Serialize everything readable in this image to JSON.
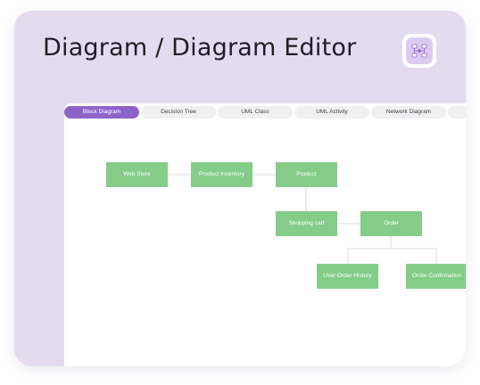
{
  "header": {
    "title": "Diagram / Diagram Editor",
    "icon": "diagram-editor-icon"
  },
  "tabs": [
    {
      "label": "Block Diagram",
      "active": true
    },
    {
      "label": "Decision Tree",
      "active": false
    },
    {
      "label": "UML Class",
      "active": false
    },
    {
      "label": "UML Activity",
      "active": false
    },
    {
      "label": "Network Diagram",
      "active": false
    },
    {
      "label": "",
      "active": false
    }
  ],
  "diagram": {
    "nodes": [
      {
        "id": "web-store",
        "label": "Web Store"
      },
      {
        "id": "product-inventory",
        "label": "Product Inventory"
      },
      {
        "id": "product",
        "label": "Product"
      },
      {
        "id": "shopping-cart",
        "label": "Shopping cart"
      },
      {
        "id": "order",
        "label": "Order"
      },
      {
        "id": "user-order-history",
        "label": "User Order History"
      },
      {
        "id": "order-confirmation",
        "label": "Order Confirmation"
      }
    ],
    "edges": [
      [
        "web-store",
        "product-inventory"
      ],
      [
        "product-inventory",
        "product"
      ],
      [
        "product",
        "shopping-cart"
      ],
      [
        "shopping-cart",
        "order"
      ],
      [
        "order",
        "user-order-history"
      ],
      [
        "order",
        "order-confirmation"
      ]
    ]
  },
  "colors": {
    "card_background": "#e4dcee",
    "accent": "#8e63c9",
    "node_fill": "#84cc88",
    "connector": "#d6d9de"
  }
}
